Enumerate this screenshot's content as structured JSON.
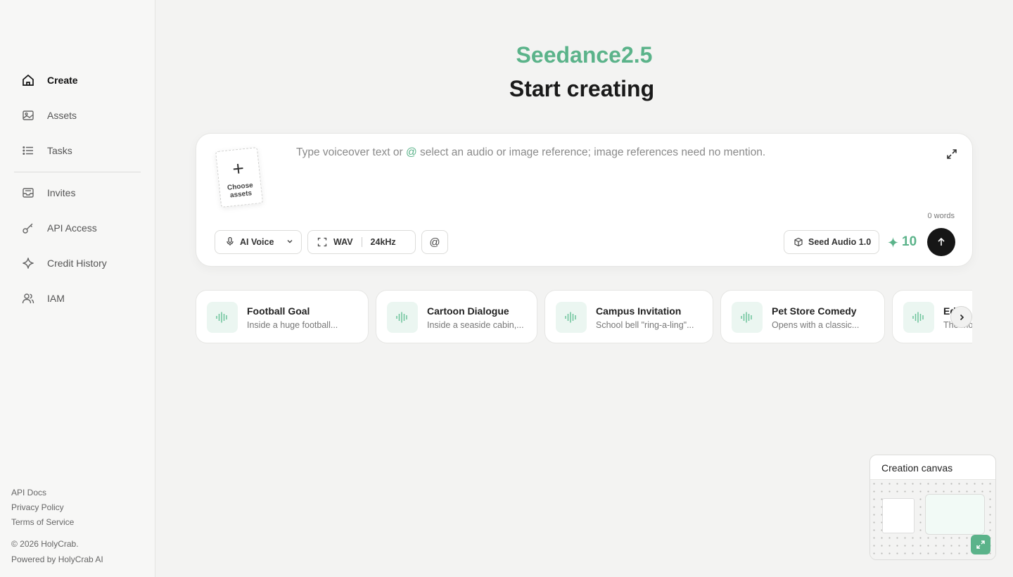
{
  "sidebar": {
    "items": [
      {
        "label": "Create",
        "icon": "home-icon"
      },
      {
        "label": "Assets",
        "icon": "image-icon"
      },
      {
        "label": "Tasks",
        "icon": "list-icon"
      },
      {
        "label": "Invites",
        "icon": "inbox-icon"
      },
      {
        "label": "API Access",
        "icon": "key-icon"
      },
      {
        "label": "Credit History",
        "icon": "sparkle-icon"
      },
      {
        "label": "IAM",
        "icon": "users-icon"
      }
    ],
    "footer": {
      "api_docs": "API Docs",
      "privacy": "Privacy Policy",
      "terms": "Terms of Service",
      "copyright": "© 2026 HolyCrab.",
      "powered": "Powered by HolyCrab AI"
    }
  },
  "hero": {
    "brand": "Seedance2.5",
    "title": "Start creating"
  },
  "composer": {
    "choose_assets": "Choose assets",
    "placeholder_prefix": "Type voiceover text or ",
    "placeholder_at": "@",
    "placeholder_suffix": " select an audio or image reference; image references need no mention.",
    "word_count": "0 words",
    "voice_label": "AI Voice",
    "format_label": "WAV",
    "rate_label": "24kHz",
    "mention_symbol": "@",
    "model_label": "Seed Audio 1.0",
    "credits": "10"
  },
  "suggestions": [
    {
      "title": "Football Goal",
      "desc": "Inside a huge football..."
    },
    {
      "title": "Cartoon Dialogue",
      "desc": "Inside a seaside cabin,..."
    },
    {
      "title": "Campus Invitation",
      "desc": "School bell \"ring-a-ling\"..."
    },
    {
      "title": "Pet Store Comedy",
      "desc": "Opens with a classic..."
    },
    {
      "title": "Ed",
      "desc": "The mo"
    }
  ],
  "canvas_widget": {
    "title": "Creation canvas"
  },
  "colors": {
    "accent": "#5bb38a",
    "send_button": "#161616"
  }
}
